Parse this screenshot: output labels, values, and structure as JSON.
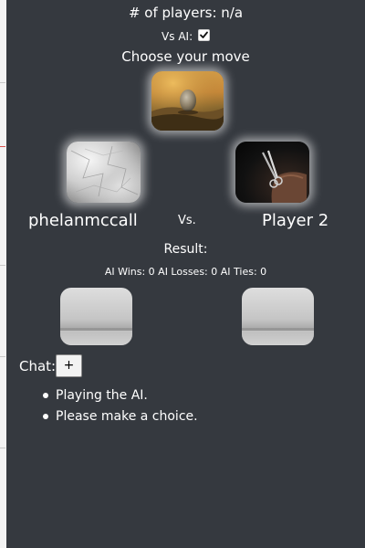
{
  "game": {
    "players_text": "# of players: n/a",
    "vs_ai_label": "Vs AI:",
    "vs_ai_checked": true,
    "choose_prompt": "Choose your move"
  },
  "moves": {
    "rock_icon": "rock-photo-icon",
    "paper_icon": "crumpled-paper-icon",
    "scissors_icon": "scissors-hand-icon",
    "empty_icon": "empty-room-icon"
  },
  "matchup": {
    "player1": "phelanmccall",
    "vs_label": "Vs.",
    "player2": "Player 2"
  },
  "result": {
    "label": "Result:",
    "stats_text": "AI Wins: 0 AI Losses: 0 AI Ties: 0"
  },
  "chat": {
    "label": "Chat:",
    "add_label": "+",
    "messages": [
      "Playing the AI.",
      "Please make a choice."
    ]
  },
  "colors": {
    "panel_bg": "#35393f",
    "text": "#ffffff",
    "tile_glow": "rgba(255,255,255,0.55)"
  }
}
